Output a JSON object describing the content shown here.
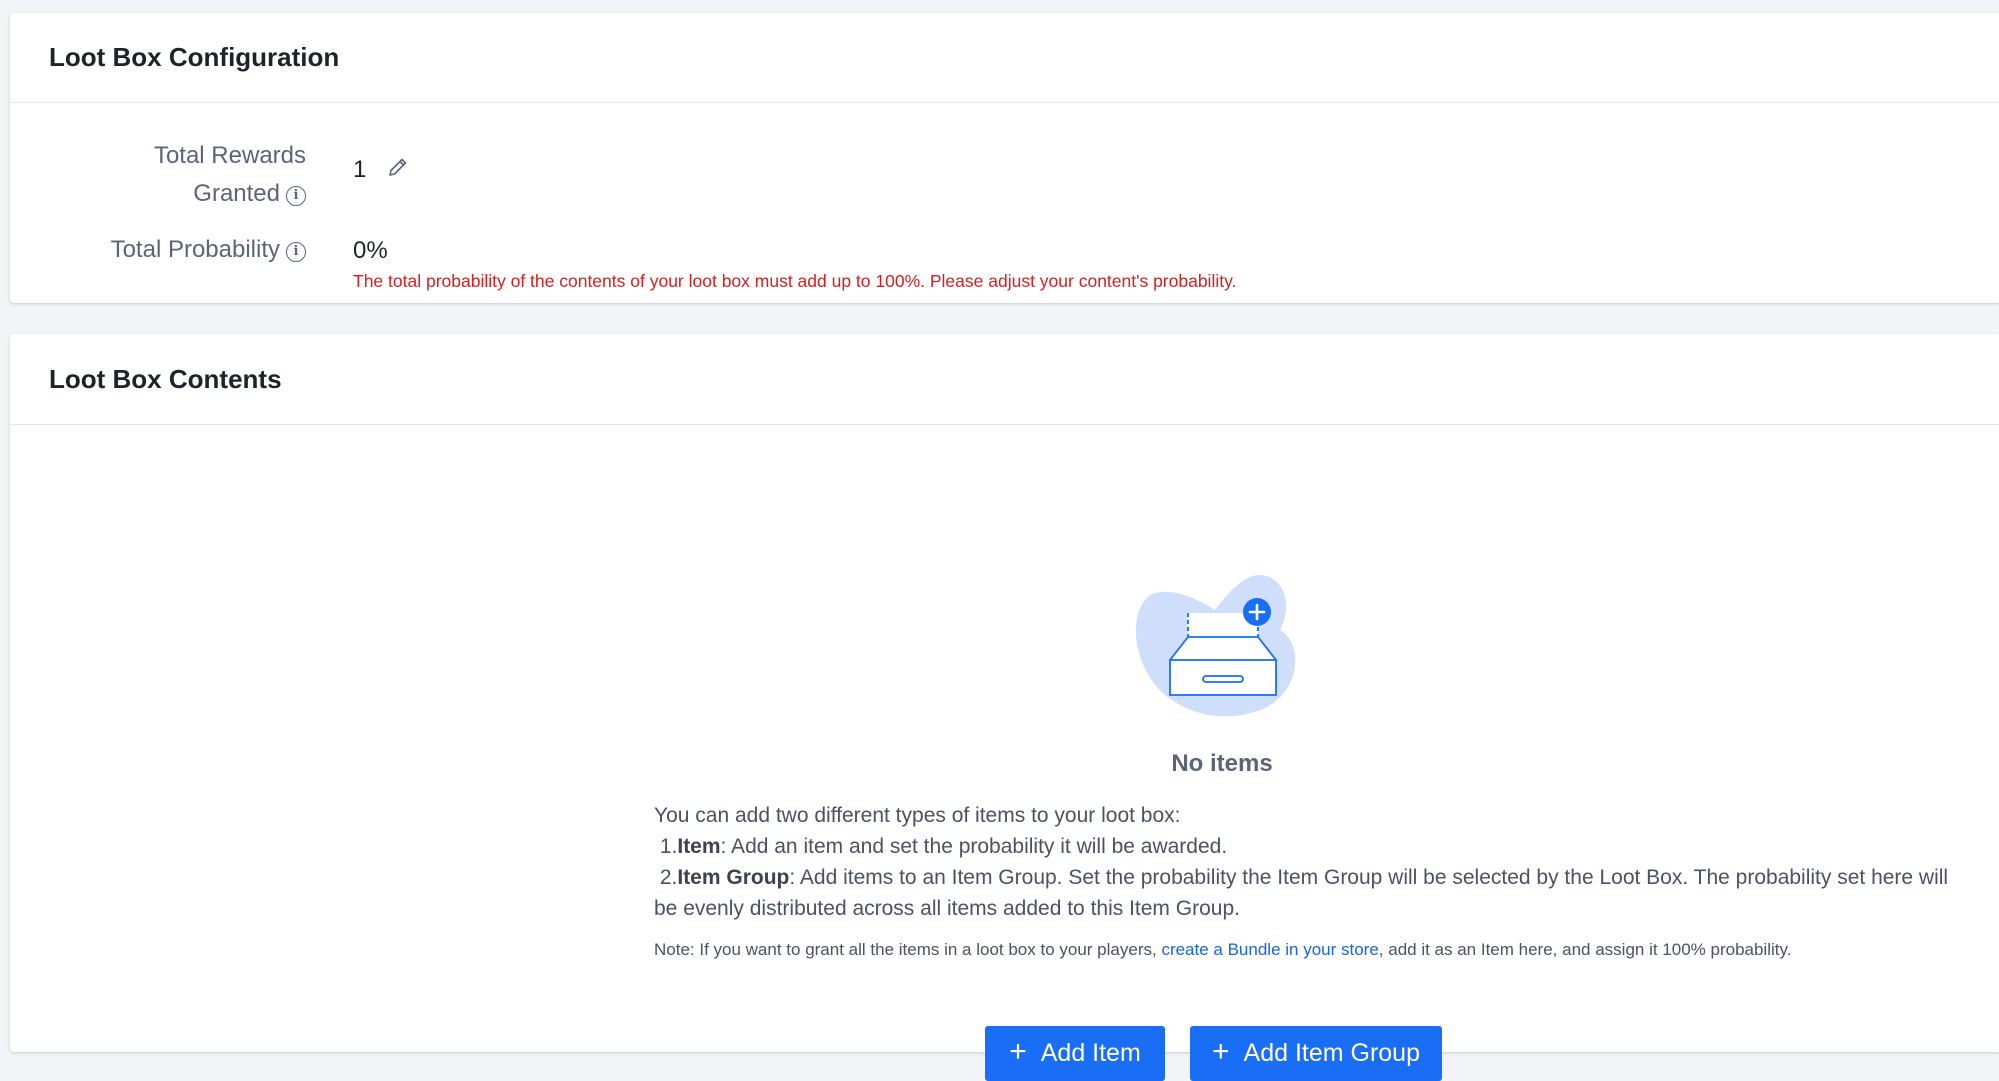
{
  "config": {
    "title": "Loot Box Configuration",
    "rewards_label_line1": "Total Rewards",
    "rewards_label_line2": "Granted",
    "rewards_value": "1",
    "probability_label": "Total Probability",
    "probability_value": "0%",
    "probability_error": "The total probability of the contents of your loot box must add up to 100%. Please adjust your content's probability."
  },
  "contents": {
    "title": "Loot Box Contents",
    "empty_title": "No items",
    "desc_intro": "You can add two different types of items to your loot box:",
    "item_prefix": "1.",
    "item_term": "Item",
    "item_text": ": Add an item and set the probability it will be awarded.",
    "group_prefix": "2.",
    "group_term": "Item Group",
    "group_text": ": Add items to an Item Group. Set the probability the Item Group will be selected by the Loot Box. The probability set here will be evenly distributed across all items added to this Item Group.",
    "note_before": "Note: If you want to grant all the items in a loot box to your players, ",
    "note_link": "create a Bundle in your store",
    "note_after": ", add it as an Item here, and assign it 100% probability.",
    "add_item_label": "Add Item",
    "add_item_group_label": "Add Item Group"
  },
  "icons": {
    "edit": "pencil-icon",
    "info": "info-icon",
    "plus": "plus-icon",
    "empty": "empty-inbox-illustration"
  },
  "colors": {
    "primary": "#1a6ef5",
    "error": "#d81e1e",
    "link": "#1666e5",
    "page_background": "#f2f4f7"
  }
}
